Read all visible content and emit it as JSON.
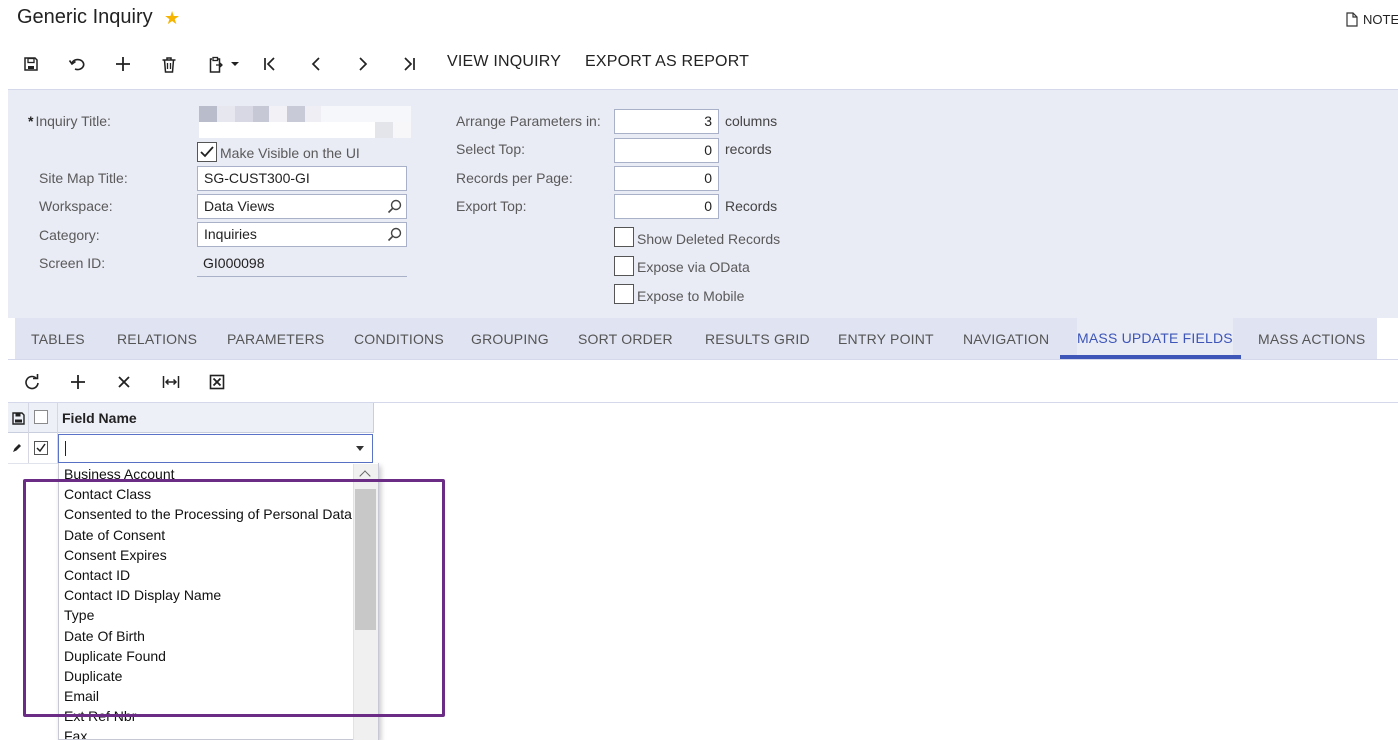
{
  "header": {
    "title": "Generic Inquiry",
    "notes_label": "NOTE"
  },
  "toolbar": {
    "icons": [
      "save-icon",
      "undo-icon",
      "add-icon",
      "delete-icon",
      "clipboard-icon",
      "first-icon",
      "previous-icon",
      "next-icon",
      "last-icon"
    ],
    "view_inquiry_label": "VIEW INQUIRY",
    "export_report_label": "EXPORT AS REPORT"
  },
  "form": {
    "inquiry_title_label": "Inquiry Title:",
    "required_mark": "*",
    "make_visible_label": "Make Visible on the UI",
    "make_visible_checked": true,
    "site_map_title_label": "Site Map Title:",
    "site_map_title_value": "SG-CUST300-GI",
    "workspace_label": "Workspace:",
    "workspace_value": "Data Views",
    "category_label": "Category:",
    "category_value": "Inquiries",
    "screen_id_label": "Screen ID:",
    "screen_id_value": "GI000098",
    "arrange_label": "Arrange Parameters in:",
    "arrange_value": "3",
    "arrange_unit": "columns",
    "select_top_label": "Select Top:",
    "select_top_value": "0",
    "select_top_unit": "records",
    "records_per_page_label": "Records per Page:",
    "records_per_page_value": "0",
    "export_top_label": "Export Top:",
    "export_top_value": "0",
    "export_top_unit": "Records",
    "show_deleted_label": "Show Deleted Records",
    "expose_odata_label": "Expose via OData",
    "expose_mobile_label": "Expose to Mobile"
  },
  "tabs": [
    {
      "label": "TABLES"
    },
    {
      "label": "RELATIONS"
    },
    {
      "label": "PARAMETERS"
    },
    {
      "label": "CONDITIONS"
    },
    {
      "label": "GROUPING"
    },
    {
      "label": "SORT ORDER"
    },
    {
      "label": "RESULTS GRID"
    },
    {
      "label": "ENTRY POINT"
    },
    {
      "label": "NAVIGATION"
    },
    {
      "label": "MASS UPDATE FIELDS",
      "active": true
    },
    {
      "label": "MASS ACTIONS"
    }
  ],
  "grid": {
    "toolbar_icons": [
      "refresh-icon",
      "add-row-icon",
      "delete-row-icon",
      "fit-columns-icon",
      "export-excel-icon"
    ],
    "column_header": "Field Name",
    "row_selected": true,
    "field_value": ""
  },
  "dropdown": {
    "options": [
      "Business Account",
      "Contact Class",
      "Consented to the Processing of Personal Data",
      "Date of Consent",
      "Consent Expires",
      "Contact ID",
      "Contact ID Display Name",
      "Type",
      "Date Of Birth",
      "Duplicate Found",
      "Duplicate",
      "Email",
      "Ext Ref Nbr",
      "Fax"
    ]
  },
  "colors": {
    "accent": "#3d56b8",
    "star": "#f4b400",
    "panel_bg": "#e9ebf5",
    "highlight_box": "#6b2c86"
  }
}
